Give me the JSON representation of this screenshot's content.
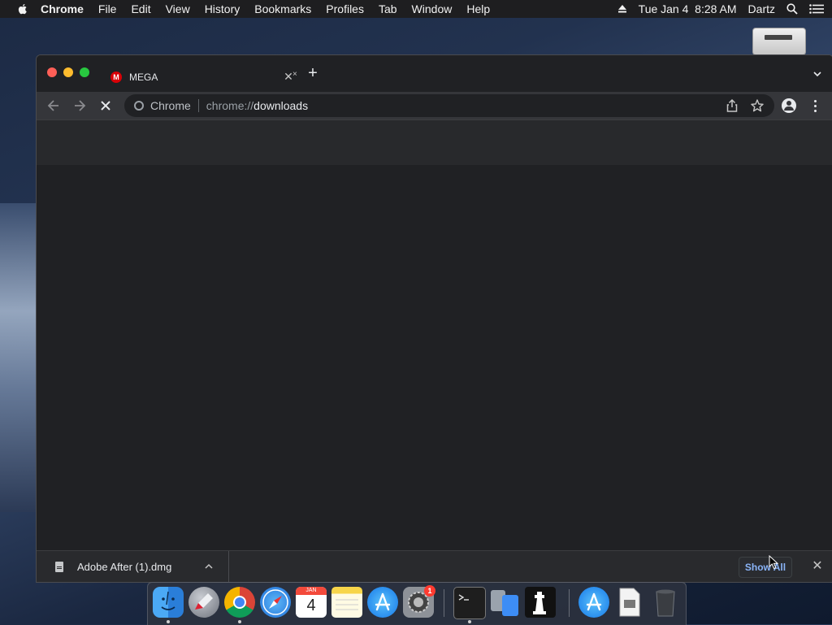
{
  "menubar": {
    "app_name": "Chrome",
    "items": [
      "File",
      "Edit",
      "View",
      "History",
      "Bookmarks",
      "Profiles",
      "Tab",
      "Window",
      "Help"
    ],
    "datetime": "Tue Jan 4  8:28 AM",
    "user": "Dartz"
  },
  "browser": {
    "tab": {
      "title": "MEGA",
      "favicon_letter": "M"
    },
    "omnibox": {
      "chip": "Chrome",
      "scheme": "chrome://",
      "host": "downloads"
    }
  },
  "download_bar": {
    "file_name": "Adobe After (1).dmg",
    "show_all": "Show All"
  },
  "dock": {
    "calendar_month": "JAN",
    "calendar_day": "4",
    "settings_badge": "1"
  },
  "colors": {
    "accent_link": "#8ab4f8",
    "traffic_red": "#ff5f57",
    "traffic_yellow": "#febc2e",
    "traffic_green": "#28c840",
    "mega_red": "#d90007"
  }
}
